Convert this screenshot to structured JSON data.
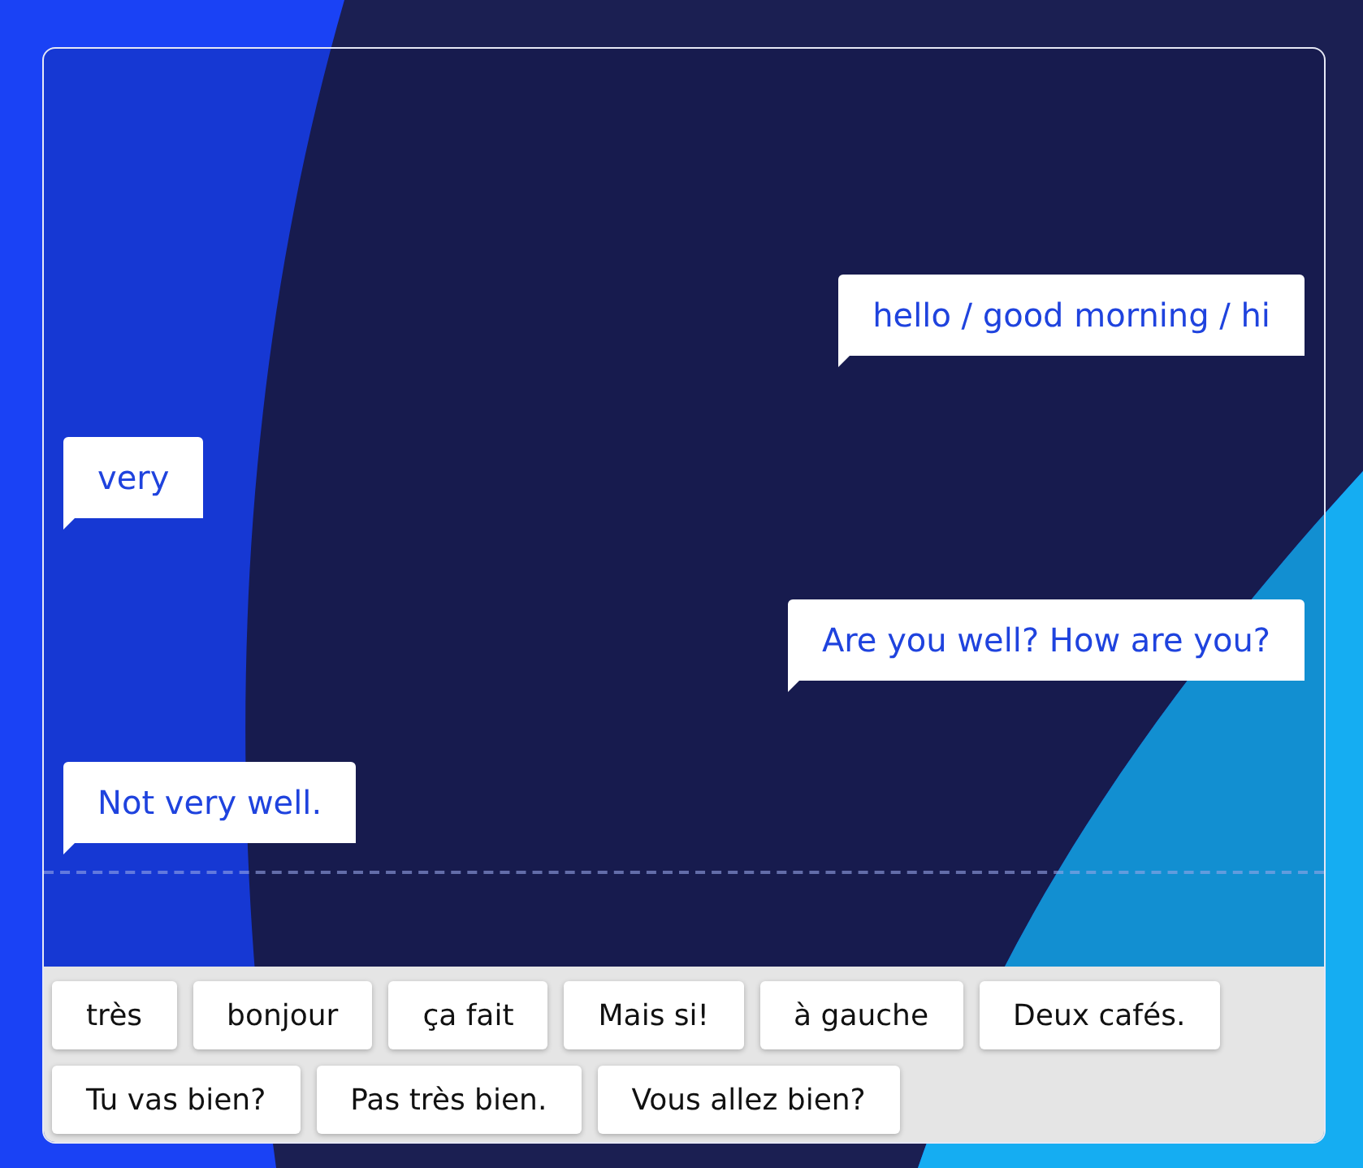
{
  "bubbles": [
    {
      "text": "hello / good morning / hi",
      "kind": "right"
    },
    {
      "text": "very",
      "kind": "left"
    },
    {
      "text": "Are you well? How are you?",
      "kind": "right"
    },
    {
      "text": "Not very well.",
      "kind": "left"
    }
  ],
  "word_bank": [
    {
      "text": "très"
    },
    {
      "text": "bonjour"
    },
    {
      "text": "ça fait"
    },
    {
      "text": "Mais si!"
    },
    {
      "text": "à gauche"
    },
    {
      "text": "Deux cafés."
    },
    {
      "text": "Tu vas bien?"
    },
    {
      "text": "Pas très bien."
    },
    {
      "text": "Vous allez bien?"
    }
  ]
}
